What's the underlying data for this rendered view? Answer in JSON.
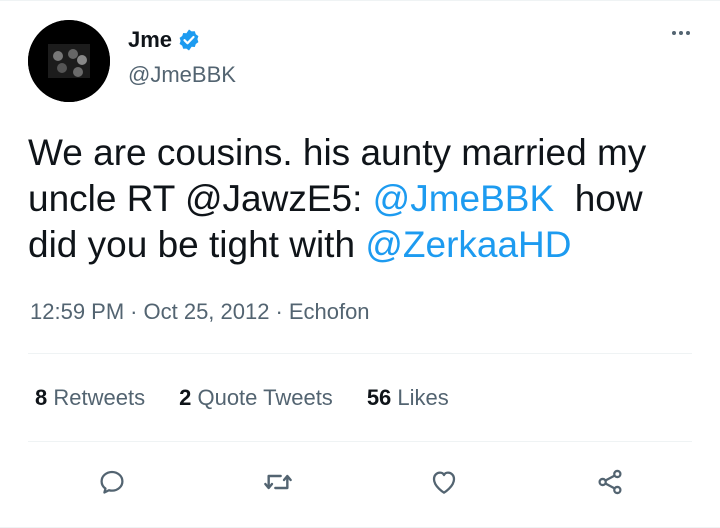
{
  "author": {
    "display_name": "Jme",
    "handle": "@JmeBBK",
    "verified": true
  },
  "tweet": {
    "text_part1": "We are cousins. his aunty married my uncle RT @JawzE5: ",
    "mention1": "@JmeBBK",
    "text_part2": "  how did you be tight with ",
    "mention2": "@ZerkaaHD"
  },
  "meta": {
    "time": "12:59 PM",
    "date": "Oct 25, 2012",
    "source": "Echofon",
    "separator": "·"
  },
  "stats": {
    "retweets_count": "8",
    "retweets_label": "Retweets",
    "quotes_count": "2",
    "quotes_label": "Quote Tweets",
    "likes_count": "56",
    "likes_label": "Likes"
  },
  "icons": {
    "reply": "reply-icon",
    "retweet": "retweet-icon",
    "like": "heart-icon",
    "share": "share-icon",
    "more": "more-icon",
    "verified": "verified-badge-icon"
  },
  "colors": {
    "link": "#1d9bf0",
    "secondary_text": "#536471",
    "primary_text": "#0f1419",
    "divider": "#eff3f4"
  }
}
